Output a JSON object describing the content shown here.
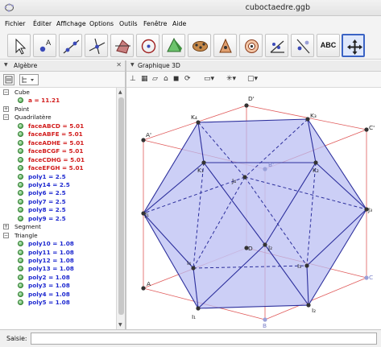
{
  "window": {
    "title": "cuboctaedre.ggb"
  },
  "menu": [
    "Fichier",
    "Éditer",
    "Affichage",
    "Options",
    "Outils",
    "Fenêtre",
    "Aide"
  ],
  "toolbar": {
    "tools": [
      "move-tool",
      "point-tool",
      "line-tool",
      "perpendicular-line-tool",
      "polygon-tool",
      "circle-tool",
      "pyramid-tool",
      "net-tool",
      "sphere-tool",
      "rotate-tool",
      "angle-tool",
      "reflect-tool",
      "text-tool",
      "move-graphics-view-tool"
    ],
    "text_tool_label": "ABC",
    "active_tool": "move-graphics-view-tool"
  },
  "algebra": {
    "header": "Algèbre",
    "items": [
      {
        "kind": "category",
        "label": "Cube",
        "toggle": "−"
      },
      {
        "kind": "value",
        "text": "a = 11.21",
        "color": "red"
      },
      {
        "kind": "category",
        "label": "Point",
        "toggle": "+"
      },
      {
        "kind": "category",
        "label": "Quadrilatère",
        "toggle": "−"
      },
      {
        "kind": "value",
        "text": "faceABCD = 5.01",
        "color": "red"
      },
      {
        "kind": "value",
        "text": "faceABFE = 5.01",
        "color": "red"
      },
      {
        "kind": "value",
        "text": "faceADHE = 5.01",
        "color": "red"
      },
      {
        "kind": "value",
        "text": "faceBCGF = 5.01",
        "color": "red"
      },
      {
        "kind": "value",
        "text": "faceCDHG = 5.01",
        "color": "red"
      },
      {
        "kind": "value",
        "text": "faceEFGH = 5.01",
        "color": "red"
      },
      {
        "kind": "value",
        "text": "poly1 = 2.5",
        "color": "blue"
      },
      {
        "kind": "value",
        "text": "poly14 = 2.5",
        "color": "blue"
      },
      {
        "kind": "value",
        "text": "poly6 = 2.5",
        "color": "blue"
      },
      {
        "kind": "value",
        "text": "poly7 = 2.5",
        "color": "blue"
      },
      {
        "kind": "value",
        "text": "poly8 = 2.5",
        "color": "blue"
      },
      {
        "kind": "value",
        "text": "poly9 = 2.5",
        "color": "blue"
      },
      {
        "kind": "category",
        "label": "Segment",
        "toggle": "+"
      },
      {
        "kind": "category",
        "label": "Triangle",
        "toggle": "−"
      },
      {
        "kind": "value",
        "text": "poly10 = 1.08",
        "color": "blue"
      },
      {
        "kind": "value",
        "text": "poly11 = 1.08",
        "color": "blue"
      },
      {
        "kind": "value",
        "text": "poly12 = 1.08",
        "color": "blue"
      },
      {
        "kind": "value",
        "text": "poly13 = 1.08",
        "color": "blue"
      },
      {
        "kind": "value",
        "text": "poly2 = 1.08",
        "color": "blue"
      },
      {
        "kind": "value",
        "text": "poly3 = 1.08",
        "color": "blue"
      },
      {
        "kind": "value",
        "text": "poly4 = 1.08",
        "color": "blue"
      },
      {
        "kind": "value",
        "text": "poly5 = 1.08",
        "color": "blue"
      }
    ]
  },
  "graphics3d": {
    "header": "Graphique 3D",
    "colors": {
      "red_text": "#d21d1d",
      "blue_text": "#1f2ad0",
      "cube_edges": "#e05a5a",
      "solid_fill": "#b9bdf2",
      "solid_edges": "#2c2f9c",
      "point_dark": "#333333",
      "point_light": "#9aa0d8"
    },
    "point_labels": {
      "K4": "K₄",
      "K3": "K₃",
      "K1": "K₁",
      "K2": "K₂",
      "J4": "J₄",
      "J3": "J₃",
      "J2": "J₂",
      "J1": "J₁",
      "I4": "I₄",
      "I3": "I₃",
      "I1": "I₁",
      "I2": "I₂",
      "A": "A",
      "B": "B",
      "C": "C",
      "D": "D",
      "A2": "A'",
      "B2": "B'",
      "C2": "C'",
      "D2": "D'"
    }
  },
  "input": {
    "label": "Saisie:",
    "value": ""
  }
}
